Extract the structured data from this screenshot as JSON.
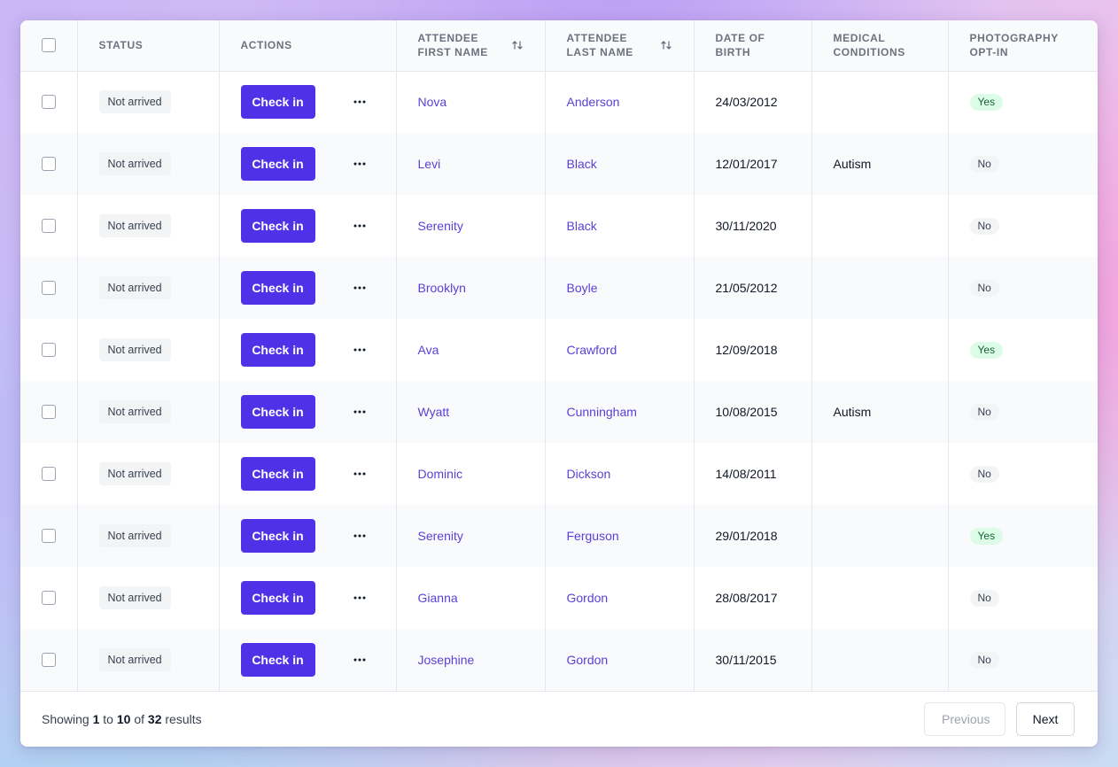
{
  "table": {
    "headers": {
      "status": "STATUS",
      "actions": "ACTIONS",
      "first_name_1": "ATTENDEE",
      "first_name_2": "FIRST NAME",
      "last_name_1": "ATTENDEE",
      "last_name_2": "LAST NAME",
      "dob_1": "DATE OF",
      "dob_2": "BIRTH",
      "medical_1": "MEDICAL",
      "medical_2": "CONDITIONS",
      "photo_1": "PHOTOGRAPHY",
      "photo_2": "OPT-IN"
    },
    "check_in_label": "Check in",
    "rows": [
      {
        "status": "Not arrived",
        "first": "Nova",
        "last": "Anderson",
        "dob": "24/03/2012",
        "medical": "",
        "photo": "Yes"
      },
      {
        "status": "Not arrived",
        "first": "Levi",
        "last": "Black",
        "dob": "12/01/2017",
        "medical": "Autism",
        "photo": "No"
      },
      {
        "status": "Not arrived",
        "first": "Serenity",
        "last": "Black",
        "dob": "30/11/2020",
        "medical": "",
        "photo": "No"
      },
      {
        "status": "Not arrived",
        "first": "Brooklyn",
        "last": "Boyle",
        "dob": "21/05/2012",
        "medical": "",
        "photo": "No"
      },
      {
        "status": "Not arrived",
        "first": "Ava",
        "last": "Crawford",
        "dob": "12/09/2018",
        "medical": "",
        "photo": "Yes"
      },
      {
        "status": "Not arrived",
        "first": "Wyatt",
        "last": "Cunningham",
        "dob": "10/08/2015",
        "medical": "Autism",
        "photo": "No"
      },
      {
        "status": "Not arrived",
        "first": "Dominic",
        "last": "Dickson",
        "dob": "14/08/2011",
        "medical": "",
        "photo": "No"
      },
      {
        "status": "Not arrived",
        "first": "Serenity",
        "last": "Ferguson",
        "dob": "29/01/2018",
        "medical": "",
        "photo": "Yes"
      },
      {
        "status": "Not arrived",
        "first": "Gianna",
        "last": "Gordon",
        "dob": "28/08/2017",
        "medical": "",
        "photo": "No"
      },
      {
        "status": "Not arrived",
        "first": "Josephine",
        "last": "Gordon",
        "dob": "30/11/2015",
        "medical": "",
        "photo": "No"
      }
    ]
  },
  "footer": {
    "showing": "Showing",
    "from": "1",
    "to_word": "to",
    "to": "10",
    "of_word": "of",
    "total": "32",
    "results": "results",
    "previous": "Previous",
    "next": "Next"
  },
  "colors": {
    "accent": "#4f31e8",
    "link": "#5b3fd6",
    "yes_bg": "#dcfce7",
    "no_bg": "#f3f4f6"
  },
  "icons": {
    "sort": "sort-arrows-icon",
    "more": "more-horizontal-icon"
  }
}
